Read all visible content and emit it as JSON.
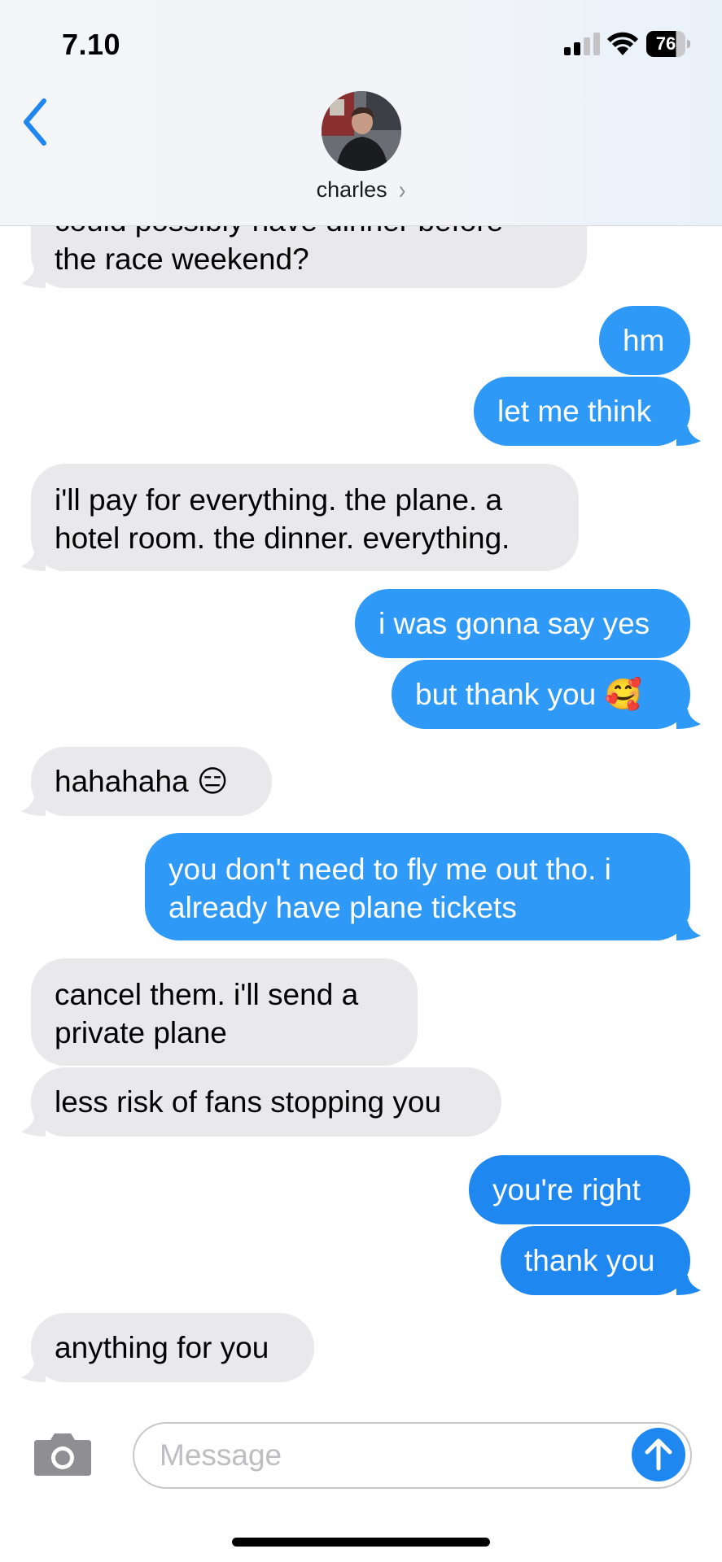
{
  "status_bar": {
    "time": "7.10",
    "battery_percent": "76",
    "battery_level": 0.76,
    "signal_bars": 2
  },
  "header": {
    "contact_name": "charles",
    "chevron": "›"
  },
  "messages": [
    {
      "side": "in",
      "text": "could possibly have dinner before"
    },
    {
      "side": "in",
      "text": "the race weekend?"
    },
    {
      "side": "out",
      "text": "hm"
    },
    {
      "side": "out",
      "text": "let me think"
    },
    {
      "side": "in",
      "text": "i'll pay for everything. the plane. a"
    },
    {
      "side": "in",
      "text": "hotel room. the dinner. everything."
    },
    {
      "side": "out",
      "text": "i was gonna say yes"
    },
    {
      "side": "out",
      "text": "but thank you 🥰"
    },
    {
      "side": "in",
      "text": "hahahaha 😑"
    },
    {
      "side": "out",
      "text": "you don't need to fly me out tho. i"
    },
    {
      "side": "out",
      "text": "already have plane tickets"
    },
    {
      "side": "in",
      "text": "cancel them. i'll send a"
    },
    {
      "side": "in",
      "text": "private plane"
    },
    {
      "side": "in",
      "text": "less risk of fans stopping you"
    },
    {
      "side": "out",
      "text": "you're right"
    },
    {
      "side": "out",
      "text": "thank you"
    },
    {
      "side": "in",
      "text": "anything for you"
    }
  ],
  "composer": {
    "placeholder": "Message"
  },
  "icons": {
    "back": "chevron-left-icon",
    "camera": "camera-icon",
    "send": "arrow-up-icon",
    "signal": "cellular-signal-icon",
    "wifi": "wifi-icon",
    "battery": "battery-icon"
  },
  "colors": {
    "incoming_bubble": "#e9e9eb",
    "outgoing_bubble": "#2f99f7",
    "accent": "#1f87f0"
  }
}
